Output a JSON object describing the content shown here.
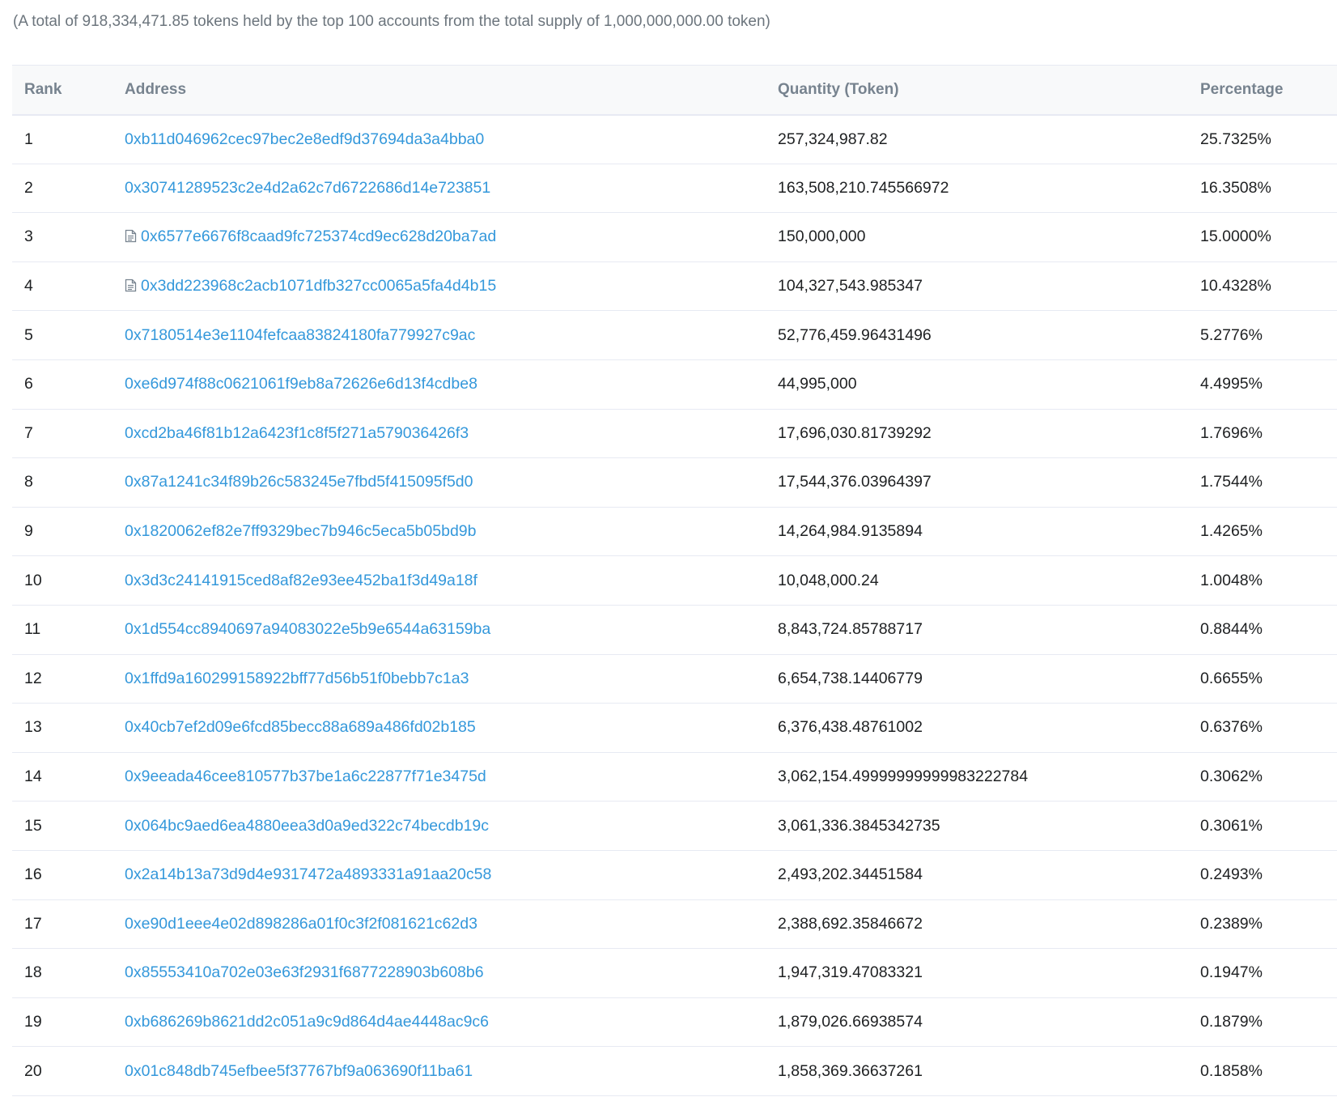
{
  "summary": "(A total of 918,334,471.85 tokens held by the top 100 accounts from the total supply of 1,000,000,000.00 token)",
  "table": {
    "headers": {
      "rank": "Rank",
      "address": "Address",
      "quantity": "Quantity (Token)",
      "percentage": "Percentage"
    },
    "rows": [
      {
        "rank": "1",
        "address": "0xb11d046962cec97bec2e8edf9d37694da3a4bba0",
        "contract": false,
        "quantity": "257,324,987.82",
        "percentage": "25.7325%"
      },
      {
        "rank": "2",
        "address": "0x30741289523c2e4d2a62c7d6722686d14e723851",
        "contract": false,
        "quantity": "163,508,210.745566972",
        "percentage": "16.3508%"
      },
      {
        "rank": "3",
        "address": "0x6577e6676f8caad9fc725374cd9ec628d20ba7ad",
        "contract": true,
        "quantity": "150,000,000",
        "percentage": "15.0000%"
      },
      {
        "rank": "4",
        "address": "0x3dd223968c2acb1071dfb327cc0065a5fa4d4b15",
        "contract": true,
        "quantity": "104,327,543.985347",
        "percentage": "10.4328%"
      },
      {
        "rank": "5",
        "address": "0x7180514e3e1104fefcaa83824180fa779927c9ac",
        "contract": false,
        "quantity": "52,776,459.96431496",
        "percentage": "5.2776%"
      },
      {
        "rank": "6",
        "address": "0xe6d974f88c0621061f9eb8a72626e6d13f4cdbe8",
        "contract": false,
        "quantity": "44,995,000",
        "percentage": "4.4995%"
      },
      {
        "rank": "7",
        "address": "0xcd2ba46f81b12a6423f1c8f5f271a579036426f3",
        "contract": false,
        "quantity": "17,696,030.81739292",
        "percentage": "1.7696%"
      },
      {
        "rank": "8",
        "address": "0x87a1241c34f89b26c583245e7fbd5f415095f5d0",
        "contract": false,
        "quantity": "17,544,376.03964397",
        "percentage": "1.7544%"
      },
      {
        "rank": "9",
        "address": "0x1820062ef82e7ff9329bec7b946c5eca5b05bd9b",
        "contract": false,
        "quantity": "14,264,984.9135894",
        "percentage": "1.4265%"
      },
      {
        "rank": "10",
        "address": "0x3d3c24141915ced8af82e93ee452ba1f3d49a18f",
        "contract": false,
        "quantity": "10,048,000.24",
        "percentage": "1.0048%"
      },
      {
        "rank": "11",
        "address": "0x1d554cc8940697a94083022e5b9e6544a63159ba",
        "contract": false,
        "quantity": "8,843,724.85788717",
        "percentage": "0.8844%"
      },
      {
        "rank": "12",
        "address": "0x1ffd9a160299158922bff77d56b51f0bebb7c1a3",
        "contract": false,
        "quantity": "6,654,738.14406779",
        "percentage": "0.6655%"
      },
      {
        "rank": "13",
        "address": "0x40cb7ef2d09e6fcd85becc88a689a486fd02b185",
        "contract": false,
        "quantity": "6,376,438.48761002",
        "percentage": "0.6376%"
      },
      {
        "rank": "14",
        "address": "0x9eeada46cee810577b37be1a6c22877f71e3475d",
        "contract": false,
        "quantity": "3,062,154.49999999999983222784",
        "percentage": "0.3062%"
      },
      {
        "rank": "15",
        "address": "0x064bc9aed6ea4880eea3d0a9ed322c74becdb19c",
        "contract": false,
        "quantity": "3,061,336.3845342735",
        "percentage": "0.3061%"
      },
      {
        "rank": "16",
        "address": "0x2a14b13a73d9d4e9317472a4893331a91aa20c58",
        "contract": false,
        "quantity": "2,493,202.34451584",
        "percentage": "0.2493%"
      },
      {
        "rank": "17",
        "address": "0xe90d1eee4e02d898286a01f0c3f2f081621c62d3",
        "contract": false,
        "quantity": "2,388,692.35846672",
        "percentage": "0.2389%"
      },
      {
        "rank": "18",
        "address": "0x85553410a702e03e63f2931f6877228903b608b6",
        "contract": false,
        "quantity": "1,947,319.47083321",
        "percentage": "0.1947%"
      },
      {
        "rank": "19",
        "address": "0xb686269b8621dd2c051a9c9d864d4ae4448ac9c6",
        "contract": false,
        "quantity": "1,879,026.66938574",
        "percentage": "0.1879%"
      },
      {
        "rank": "20",
        "address": "0x01c848db745efbee5f37767bf9a063690f11ba61",
        "contract": false,
        "quantity": "1,858,369.36637261",
        "percentage": "0.1858%"
      }
    ]
  },
  "colors": {
    "link": "#3498db",
    "header_bg": "#f8f9fa",
    "header_text": "#77838f",
    "border": "#e7eaf3",
    "muted_text": "#6c757d"
  },
  "icons": {
    "contract": "file-document-icon"
  }
}
